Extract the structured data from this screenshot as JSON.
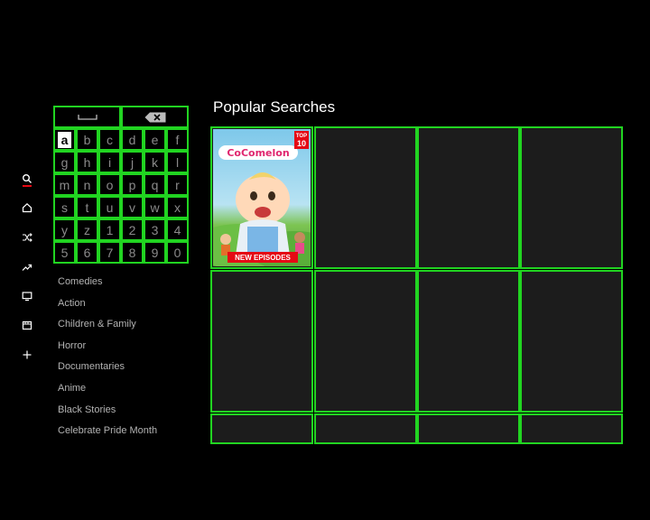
{
  "nav": {
    "items": [
      {
        "name": "search",
        "icon": "search-icon",
        "active": true
      },
      {
        "name": "home",
        "icon": "home-icon",
        "active": false
      },
      {
        "name": "shuffle",
        "icon": "shuffle-icon",
        "active": false
      },
      {
        "name": "trending",
        "icon": "trending-icon",
        "active": false
      },
      {
        "name": "tv",
        "icon": "tv-icon",
        "active": false
      },
      {
        "name": "movies",
        "icon": "movies-icon",
        "active": false
      },
      {
        "name": "my-list",
        "icon": "plus-icon",
        "active": false
      }
    ],
    "accent": "#e50914"
  },
  "keyboard": {
    "space_icon": "space-icon",
    "backspace_icon": "backspace-icon",
    "rows": [
      [
        "a",
        "b",
        "c",
        "d",
        "e",
        "f"
      ],
      [
        "g",
        "h",
        "i",
        "j",
        "k",
        "l"
      ],
      [
        "m",
        "n",
        "o",
        "p",
        "q",
        "r"
      ],
      [
        "s",
        "t",
        "u",
        "v",
        "w",
        "x"
      ],
      [
        "y",
        "z",
        "1",
        "2",
        "3",
        "4"
      ],
      [
        "5",
        "6",
        "7",
        "8",
        "9",
        "0"
      ]
    ],
    "selected": "a",
    "focus_color": "#21d421"
  },
  "genres": [
    "Comedies",
    "Action",
    "Children & Family",
    "Horror",
    "Documentaries",
    "Anime",
    "Black Stories",
    "Celebrate Pride Month"
  ],
  "results": {
    "title": "Popular Searches",
    "featured": {
      "logo": "CoComelon",
      "badge_top": "TOP",
      "badge_num": "10",
      "banner": "NEW EPISODES"
    }
  }
}
